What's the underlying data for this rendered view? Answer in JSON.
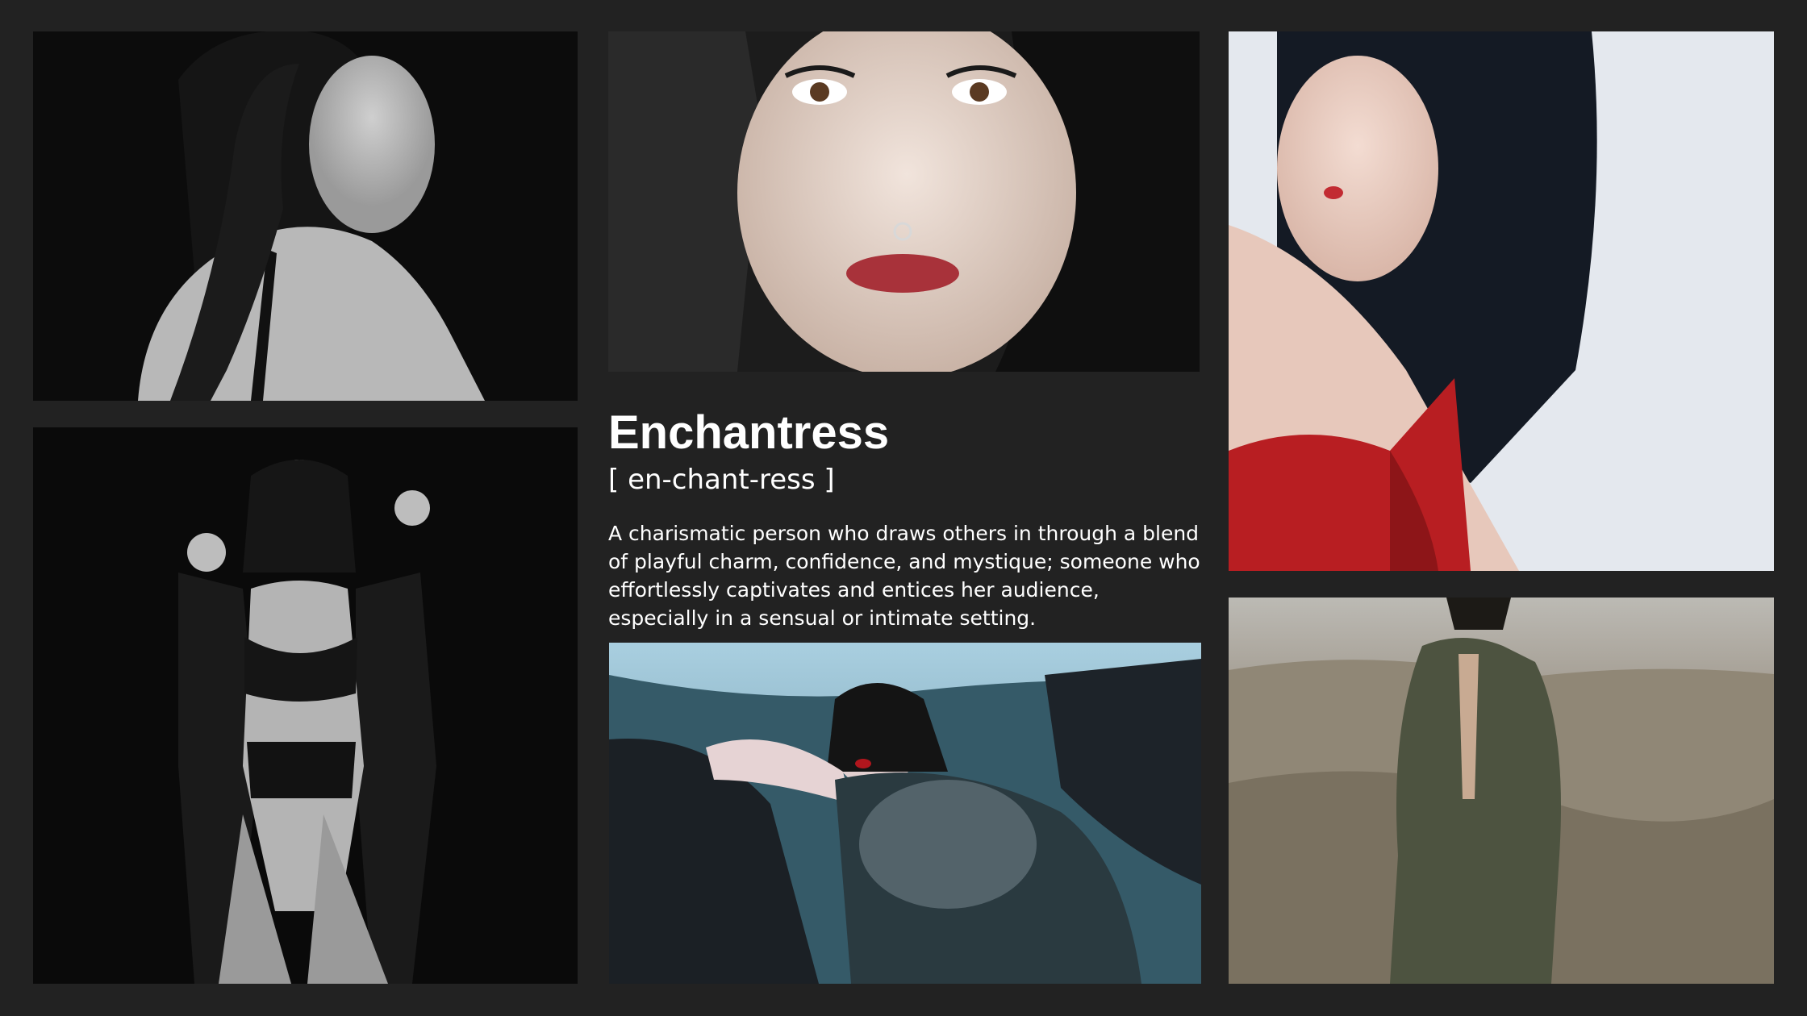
{
  "definition": {
    "word": "Enchantress",
    "pronunciation": "[ en-chant-ress ]",
    "meaning": "A charismatic person who draws others in through a blend of playful charm, confidence, and mystique; someone who effortlessly captivates and entices her audience, especially in a sensual or intimate setting."
  },
  "photos": [
    {
      "name": "photo-top-left",
      "subject": "black-and-white portrait, woman looking over shoulder"
    },
    {
      "name": "photo-top-center",
      "subject": "close-up portrait with red lips and septum ring"
    },
    {
      "name": "photo-top-right",
      "subject": "portrait in red lace lingerie, light background"
    },
    {
      "name": "photo-bottom-left",
      "subject": "black-and-white full-body portrait in lingerie"
    },
    {
      "name": "photo-bottom-center",
      "subject": "teal-toned reclining portrait in fishnets"
    },
    {
      "name": "photo-bottom-right",
      "subject": "figure in olive coat on desert dunes"
    }
  ],
  "colors": {
    "background": "#222222",
    "text": "#ffffff"
  }
}
